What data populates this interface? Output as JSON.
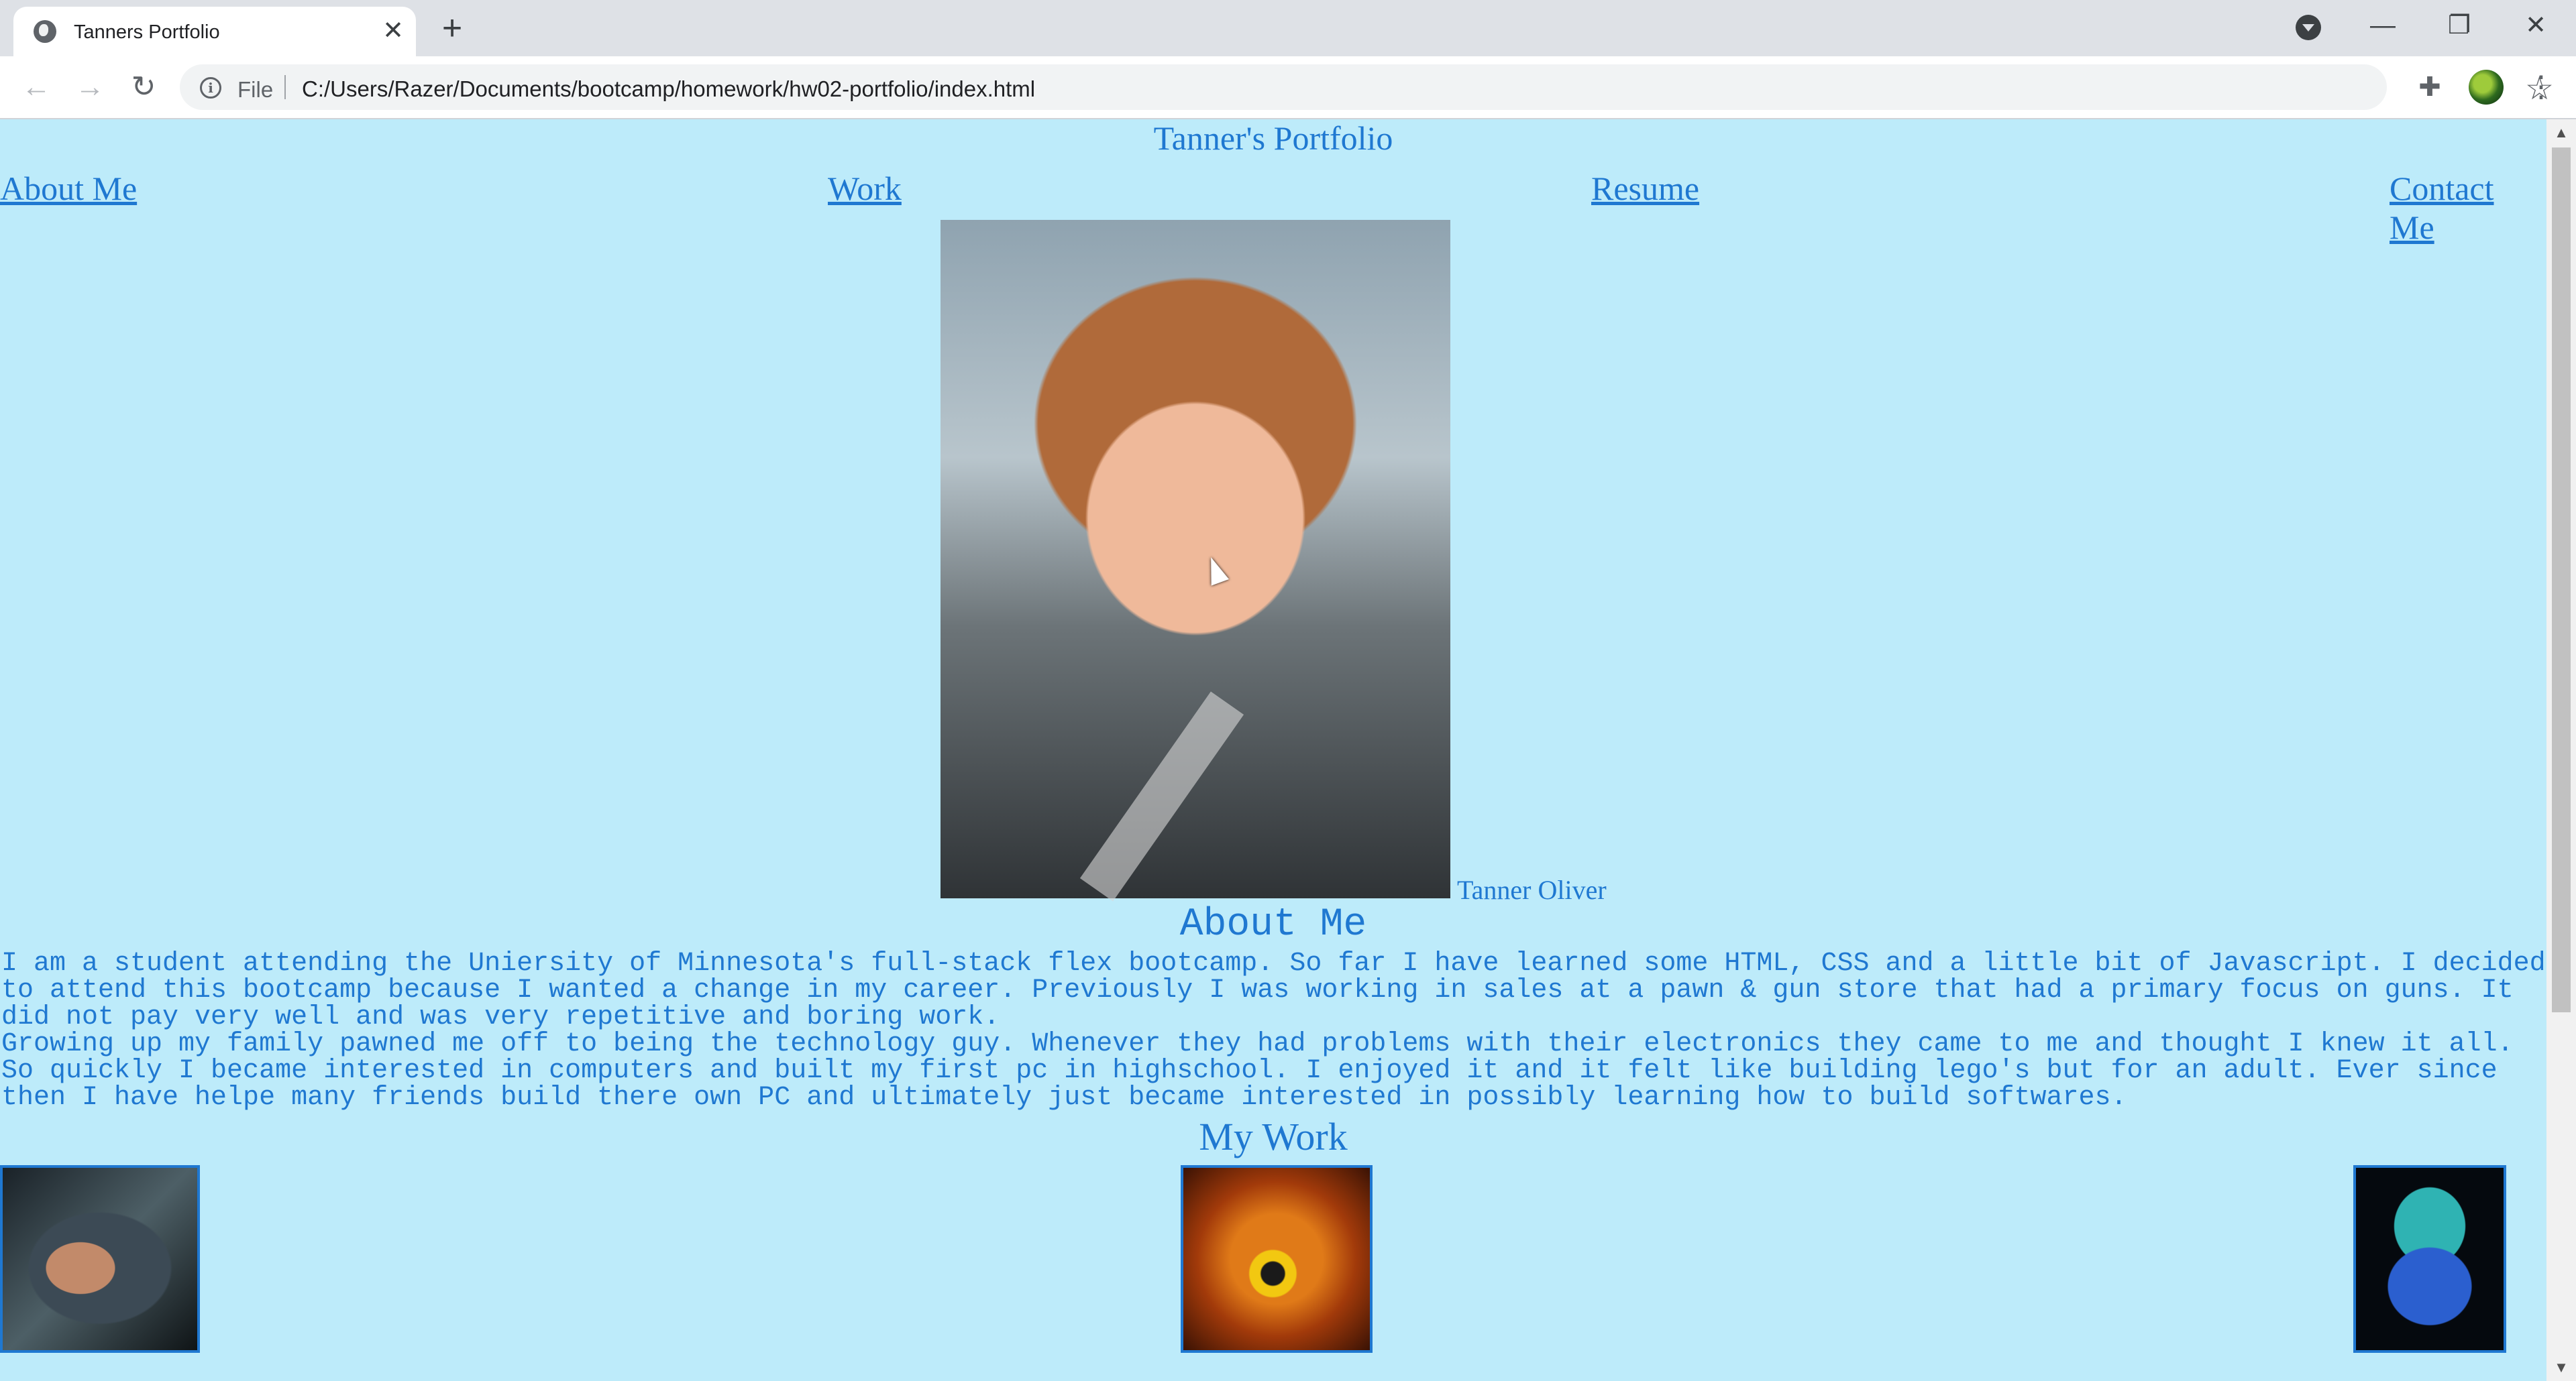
{
  "browser": {
    "tab_title": "Tanners Portfolio",
    "tab_close": "✕",
    "new_tab": "+",
    "window_minimize": "—",
    "window_restore": "❐",
    "window_close": "✕",
    "back": "←",
    "forward": "→",
    "reload": "↻",
    "info": "i",
    "scheme_label": "File",
    "url": "C:/Users/Razer/Documents/bootcamp/homework/hw02-portfolio/index.html",
    "star": "☆",
    "extensions": "✚",
    "menu": "⋮"
  },
  "page": {
    "title": "Tanner's Portfolio",
    "nav": [
      "About Me",
      "Work",
      "Resume",
      "Contact Me"
    ],
    "portrait_caption": "Tanner Oliver",
    "about_heading": "About Me",
    "about_text": "I am a student attending the Uniersity of Minnesota's full-stack flex bootcamp. So far I have learned some HTML, CSS and a little bit of Javascript. I decided\nto attend this bootcamp because I wanted a change in my career. Previously I was working in sales at a pawn & gun store that had a primary focus on guns. It\ndid not pay very well and was very repetitive and boring work.\nGrowing up my family pawned me off to being the technology guy. Whenever they had problems with their electronics they came to me and thought I knew it all.\nSo quickly I became interested in computers and built my first pc in highschool. I enjoyed it and it felt like building lego's but for an adult. Ever since\nthen I have helpe many friends build there own PC and ultimately just became interested in possibly learning how to build softwares.",
    "work_heading": "My Work"
  },
  "scrollbar": {
    "up": "▲",
    "down": "▼"
  },
  "colors": {
    "page_background": "#bdebfa",
    "link": "#1f78d1",
    "text": "#1f78d1"
  }
}
